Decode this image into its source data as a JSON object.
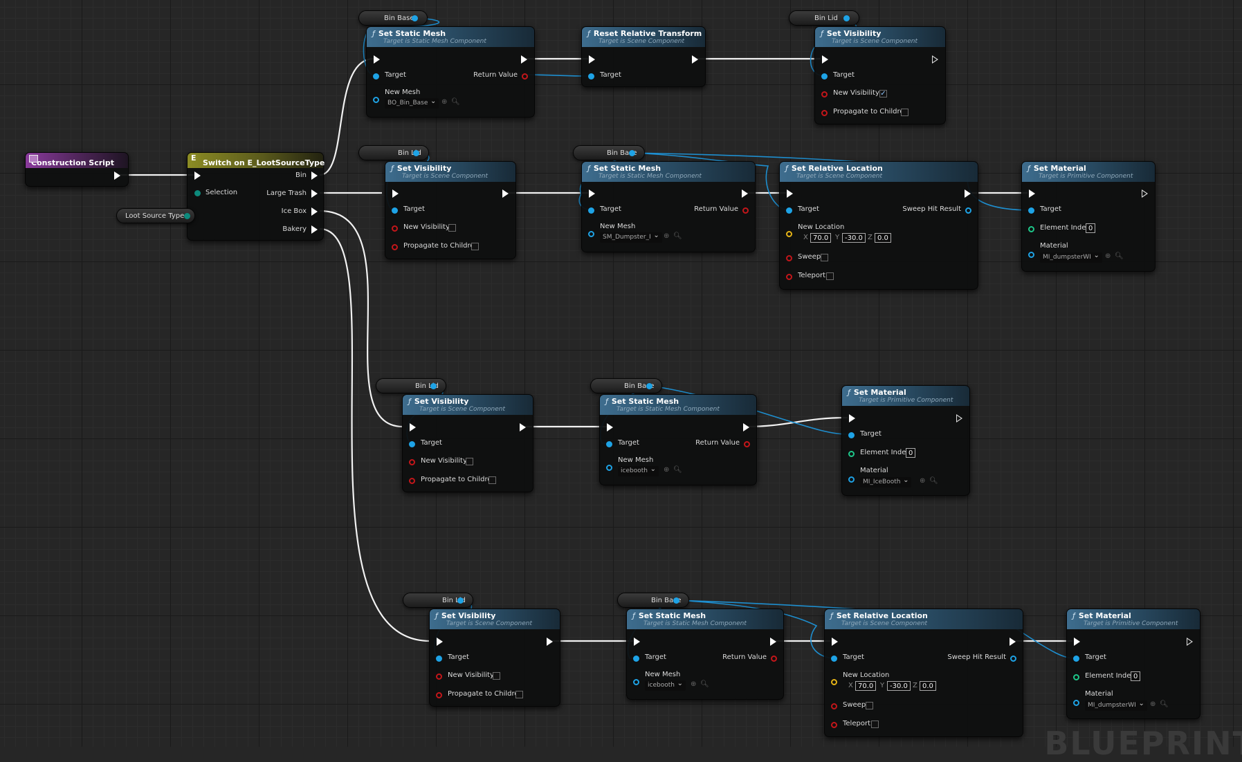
{
  "watermark": "BLUEPRINT",
  "colors": {
    "exec": "#ffffff",
    "object": "#1ea3e6",
    "bool": "#c4161a",
    "vector": "#e5b316",
    "int": "#1ec88a",
    "byte": "#0d8a7c"
  },
  "construction": {
    "title": "Construction Script"
  },
  "switch_node": {
    "title": "Switch on E_LootSourceType",
    "selection": "Selection",
    "outputs": [
      "Bin",
      "Large Trash",
      "Ice Box",
      "Bakery"
    ]
  },
  "loot_var": {
    "label": "Loot Source Type"
  },
  "labels": {
    "bin_base": "Bin Base",
    "bin_lid": "Bin Lid",
    "set_static_mesh": "Set Static Mesh",
    "sub_static_mesh": "Target is Static Mesh Component",
    "set_visibility": "Set Visibility",
    "sub_scene": "Target is Scene Component",
    "reset_transform": "Reset Relative Transform",
    "set_rel_loc": "Set Relative Location",
    "set_material": "Set Material",
    "sub_primitive": "Target is Primitive Component",
    "target": "Target",
    "return_value": "Return Value",
    "new_mesh": "New Mesh",
    "new_visibility": "New Visibility",
    "propagate": "Propagate to Children",
    "new_location": "New Location",
    "sweep": "Sweep",
    "teleport": "Teleport",
    "sweep_hit": "Sweep Hit Result",
    "element_index": "Element Index",
    "material": "Material",
    "x": "X",
    "y": "Y",
    "z": "Z"
  },
  "values": {
    "mesh_bin": "BO_Bin_Base",
    "mesh_dumpster": "SM_Dumpster_I",
    "mesh_icebooth": "icebooth",
    "mat_dumpster": "MI_dumpsterWI",
    "mat_icebooth": "MI_IceBooth",
    "loc_x": "70.0",
    "loc_y": "-30.0",
    "loc_z": "0.0",
    "element_index": "0",
    "check": "✓"
  }
}
